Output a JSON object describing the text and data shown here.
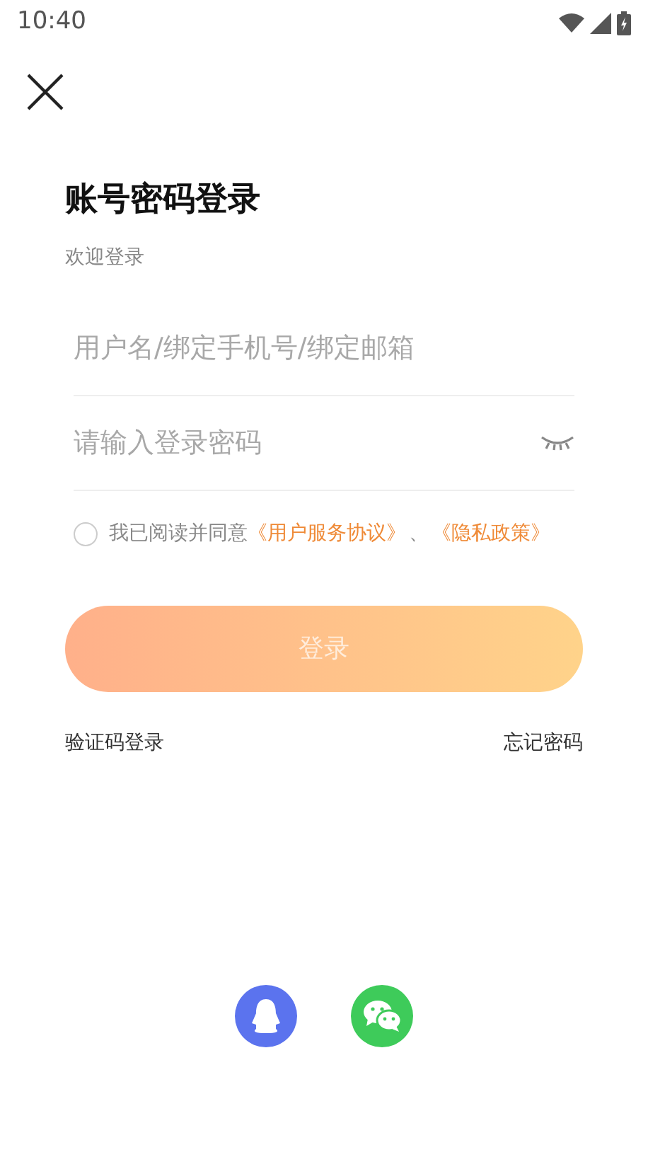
{
  "status_bar": {
    "time": "10:40"
  },
  "title": "账号密码登录",
  "subtitle": "欢迎登录",
  "fields": [
    {
      "kind": "text",
      "placeholder": "用户名/绑定手机号/绑定邮箱"
    },
    {
      "kind": "password",
      "placeholder": "请输入登录密码",
      "password_visible": false
    }
  ],
  "agreement": {
    "checked": false,
    "text": "我已阅读并同意",
    "links": [
      "《用户服务协议》",
      "《隐私政策》"
    ],
    "separator": "、"
  },
  "login_button": {
    "label": "登录",
    "disabled": true
  },
  "links": [
    "验证码登录",
    "忘记密码"
  ],
  "social": [
    {
      "kind": "qq"
    },
    {
      "kind": "wechat"
    }
  ]
}
